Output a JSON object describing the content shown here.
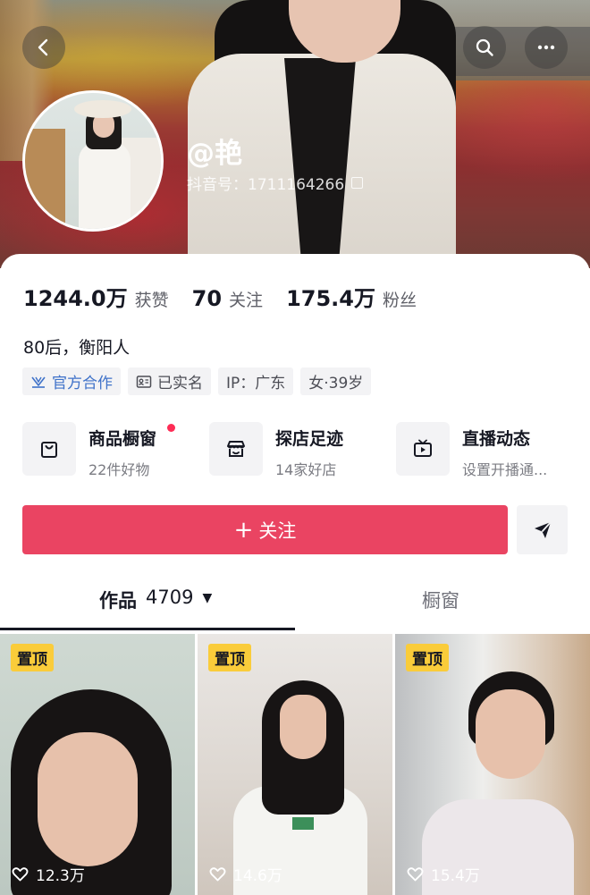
{
  "profile": {
    "nickname": "@艳",
    "douyin_id": "抖音号：1711164266",
    "bio": "80后，衡阳人"
  },
  "stats": [
    {
      "value": "1244.0万",
      "label": "获赞"
    },
    {
      "value": "70",
      "label": "关注"
    },
    {
      "value": "175.4万",
      "label": "粉丝"
    }
  ],
  "tags": [
    {
      "label": "官方合作",
      "icon": "official-cooperation-icon"
    },
    {
      "label": "已实名",
      "icon": "id-card-icon"
    },
    {
      "label": "IP：广东"
    },
    {
      "label": "女·39岁"
    }
  ],
  "features": [
    {
      "title": "商品橱窗",
      "subtitle": "22件好物",
      "icon": "shopping-bag-icon",
      "has_dot": true
    },
    {
      "title": "探店足迹",
      "subtitle": "14家好店",
      "icon": "storefront-icon"
    },
    {
      "title": "直播动态",
      "subtitle": "设置开播通...",
      "icon": "tv-icon"
    }
  ],
  "actions": {
    "follow_label": "关注",
    "follow_color": "#ea4462"
  },
  "tabs": {
    "works_label": "作品",
    "works_count": "4709",
    "window_label": "橱窗"
  },
  "videos": [
    {
      "pin_label": "置顶",
      "likes": "12.3万"
    },
    {
      "pin_label": "置顶",
      "likes": "14.6万"
    },
    {
      "pin_label": "置顶",
      "likes": "15.4万"
    }
  ],
  "colors": {
    "accent": "#fe2c55",
    "pin_badge": "#facc3a",
    "official_blue": "#3f72c9"
  }
}
